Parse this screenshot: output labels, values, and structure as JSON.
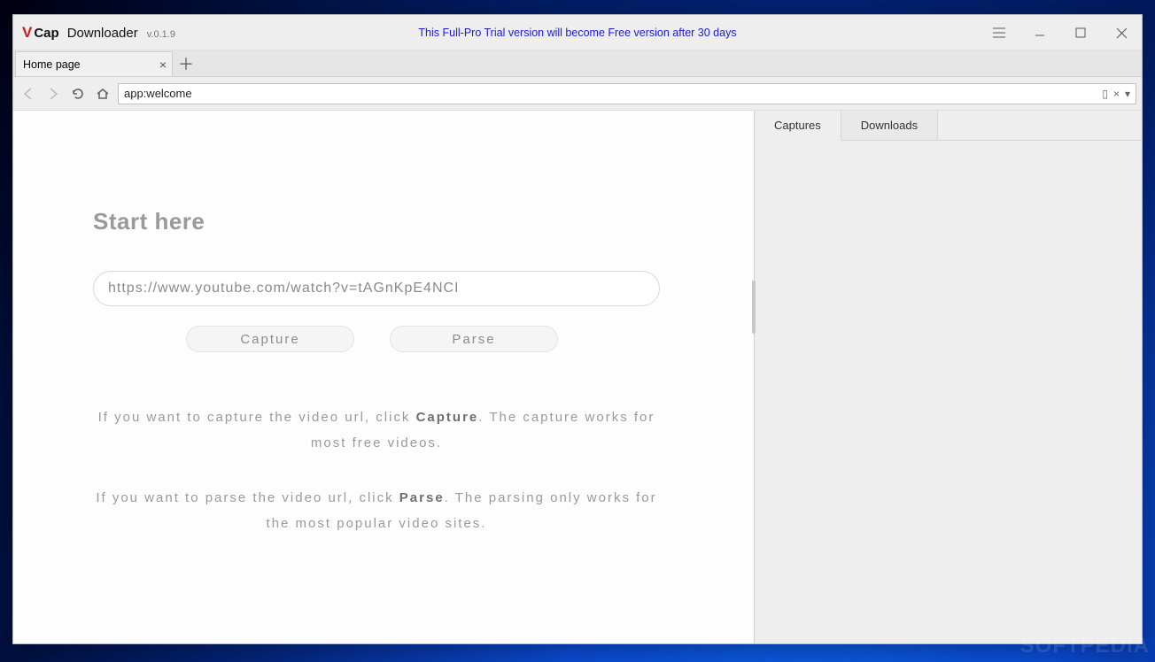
{
  "app": {
    "logo_v": "V",
    "logo_cap": "Cap",
    "logo_dl": "Downloader",
    "version": "v.0.1.9",
    "banner": "This Full-Pro Trial version will become Free version after 30 days"
  },
  "tabs": [
    {
      "label": "Home page"
    }
  ],
  "address_value": "app:welcome",
  "welcome": {
    "heading": "Start here",
    "url_value": "https://www.youtube.com/watch?v=tAGnKpE4NCI",
    "capture_label": "Capture",
    "parse_label": "Parse",
    "hint1_pre": "If you want to capture the video url, click ",
    "hint1_bold": "Capture",
    "hint1_post": ". The capture works for most free videos.",
    "hint2_pre": "If you want to parse the video url, click ",
    "hint2_bold": "Parse",
    "hint2_post": ". The parsing only works for the most popular video sites."
  },
  "side": {
    "tab_captures": "Captures",
    "tab_downloads": "Downloads"
  },
  "watermark": "SOFTPEDIA"
}
